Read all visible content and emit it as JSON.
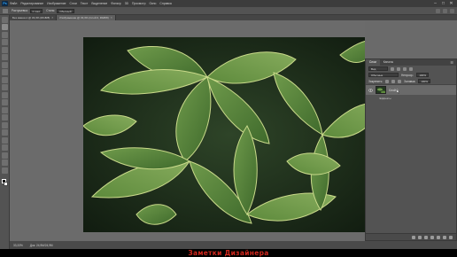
{
  "app": {
    "name": "Ps",
    "logo_icon": "photoshop-logo-icon"
  },
  "menu": [
    "Файл",
    "Редактирование",
    "Изображение",
    "Слои",
    "Текст",
    "Выделение",
    "Фильтр",
    "3D",
    "Просмотр",
    "Окно",
    "Справка"
  ],
  "window_controls": {
    "minimize": "–",
    "maximize": "□",
    "close": "✕"
  },
  "options": {
    "feather_label": "Растушевка:",
    "feather_value": "0 пикс",
    "style_label": "Стиль:",
    "style_value": "Обычный"
  },
  "tabs": [
    {
      "label": "Без имени-1 @ 33,3% (RGB/8)",
      "close": "×"
    },
    {
      "label": "Изображение @ 33,3% (Слой 0, RGB/8)",
      "close": "×"
    }
  ],
  "status": {
    "zoom": "33,33%",
    "doc_info": "Док: 24,9M/24,9M"
  },
  "layers_panel": {
    "tabs": [
      "Слои",
      "Каналы"
    ],
    "menu_icon": "☰",
    "kind_label": "Вид",
    "blend_mode": "Обычные",
    "opacity_label": "Непрозр.:",
    "opacity_value": "100%",
    "lock_label": "Закрепить:",
    "fill_label": "Заливка:",
    "fill_value": "100%",
    "layers": [
      {
        "name": "Слой 0",
        "visible": true,
        "selected": true
      }
    ],
    "sub_items": [
      {
        "name": "Эффекты"
      }
    ]
  },
  "caption": "Заметки Дизайнера",
  "colors": {
    "caption": "#d0271d",
    "workspace": "#6b6b6b",
    "panel": "#535353"
  }
}
